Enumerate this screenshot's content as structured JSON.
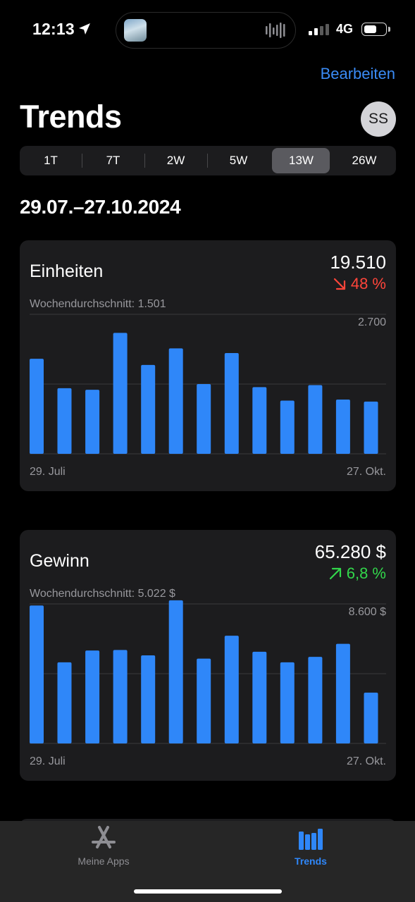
{
  "status_bar": {
    "time": "12:13",
    "network": "4G"
  },
  "header": {
    "edit_label": "Bearbeiten",
    "title": "Trends",
    "avatar_initials": "SS"
  },
  "segmented": {
    "options": [
      "1T",
      "7T",
      "2W",
      "5W",
      "13W",
      "26W"
    ],
    "selected": "13W"
  },
  "date_range": "29.07.–27.10.2024",
  "cards": [
    {
      "title": "Einheiten",
      "total": "19.510",
      "change": "48 %",
      "change_direction": "down",
      "average": "Wochendurchschnitt: 1.501",
      "max_label": "2.700",
      "x_start": "29. Juli",
      "x_end": "27. Okt."
    },
    {
      "title": "Gewinn",
      "total": "65.280 $",
      "change": "6,8 %",
      "change_direction": "up",
      "average": "Wochendurchschnitt: 5.022 $",
      "max_label": "8.600 $",
      "x_start": "29. Juli",
      "x_end": "27. Okt."
    }
  ],
  "chart_data": [
    {
      "type": "bar",
      "title": "Einheiten",
      "ylim": [
        0,
        2700
      ],
      "grid": true,
      "values": [
        1840,
        1270,
        1240,
        2340,
        1720,
        2040,
        1350,
        1950,
        1290,
        1030,
        1330,
        1050,
        1010
      ]
    },
    {
      "type": "bar",
      "title": "Gewinn",
      "ylim": [
        0,
        8600
      ],
      "grid": true,
      "values": [
        8500,
        5000,
        5730,
        5760,
        5430,
        8820,
        5230,
        6640,
        5650,
        5000,
        5340,
        6140,
        3130
      ]
    }
  ],
  "tabbar": {
    "items": [
      {
        "label": "Meine Apps",
        "icon": "appstore-icon",
        "active": false
      },
      {
        "label": "Trends",
        "icon": "trends-bars-icon",
        "active": true
      }
    ]
  },
  "colors": {
    "accent": "#3a8bf5",
    "bar": "#2f87f9",
    "negative": "#ff453a",
    "positive": "#32d74b",
    "card": "#1c1c1e"
  }
}
